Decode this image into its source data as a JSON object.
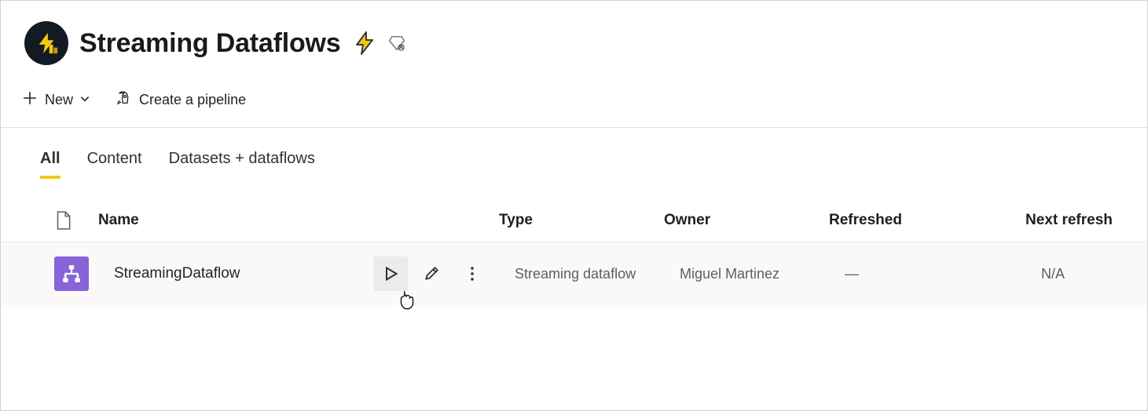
{
  "header": {
    "title": "Streaming Dataflows"
  },
  "toolbar": {
    "new_label": "New",
    "pipeline_label": "Create a pipeline"
  },
  "tabs": [
    {
      "label": "All",
      "active": true
    },
    {
      "label": "Content",
      "active": false
    },
    {
      "label": "Datasets + dataflows",
      "active": false
    }
  ],
  "table": {
    "columns": {
      "name": "Name",
      "type": "Type",
      "owner": "Owner",
      "refreshed": "Refreshed",
      "next_refresh": "Next refresh"
    },
    "rows": [
      {
        "name": "StreamingDataflow",
        "type": "Streaming dataflow",
        "owner": "Miguel Martinez",
        "refreshed": "—",
        "next_refresh": "N/A"
      }
    ]
  }
}
